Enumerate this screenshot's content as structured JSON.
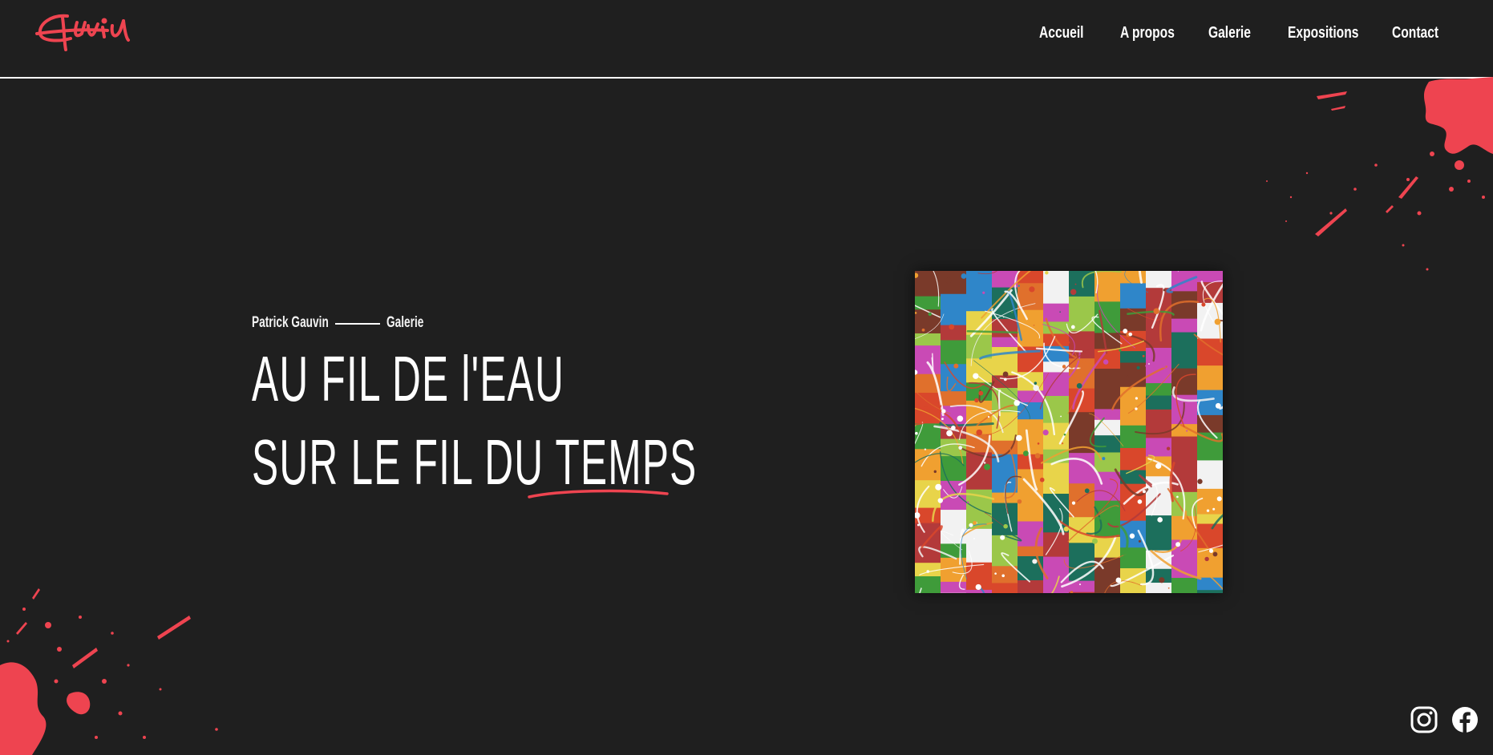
{
  "brand": {
    "logo_text": "Gauvin",
    "accent_color": "#ee4450",
    "background_color": "#1f1f1f"
  },
  "nav": {
    "items": [
      {
        "label": "Accueil"
      },
      {
        "label": "A propos"
      },
      {
        "label": "Galerie"
      },
      {
        "label": "Expositions"
      },
      {
        "label": "Contact"
      }
    ]
  },
  "hero": {
    "breadcrumb": {
      "artist": "Patrick Gauvin",
      "section": "Galerie"
    },
    "title_line1": "AU FIL DE l'EAU",
    "title_line2_start": "SUR LE FIL DU ",
    "title_line2_highlight": "TEMPS",
    "artwork_alt": "colorful abstract splatter painting"
  },
  "social": {
    "icons": [
      "instagram-icon",
      "facebook-icon"
    ]
  }
}
